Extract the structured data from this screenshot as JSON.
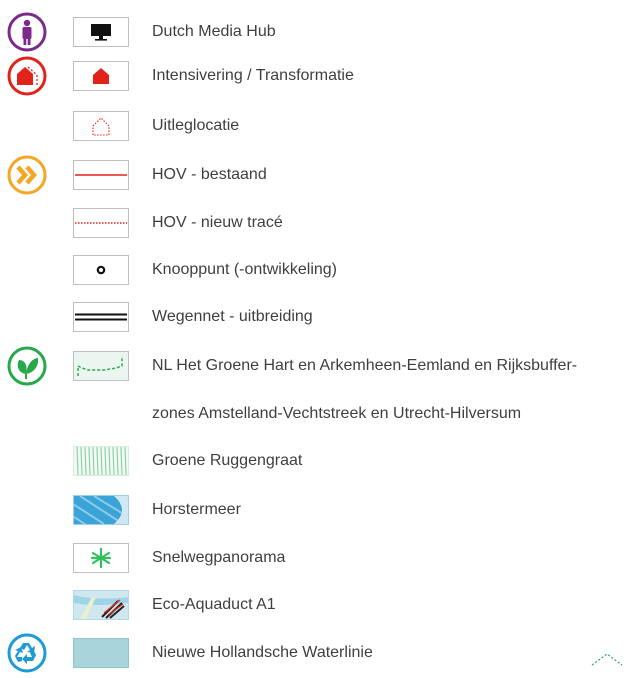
{
  "legend": {
    "items": [
      {
        "label": "Dutch Media Hub",
        "icon": "media-hub-person-icon",
        "swatch": "monitor-icon"
      },
      {
        "label": "Intensivering / Transformatie",
        "icon": "house-transform-icon",
        "swatch": "red-house-icon"
      },
      {
        "label": "Uitleglocatie",
        "swatch": "dotted-house-icon"
      },
      {
        "label": "HOV - bestaand",
        "icon": "chevron-right-double-icon",
        "swatch": "solid-red-line-icon"
      },
      {
        "label": "HOV - nieuw tracé",
        "swatch": "dotted-red-line-icon"
      },
      {
        "label": "Knooppunt (-ontwikkeling)",
        "swatch": "ring-node-icon"
      },
      {
        "label": "Wegennet - uitbreiding",
        "swatch": "double-road-icon"
      },
      {
        "label": "NL Het Groene Hart  en Arkemheen-Eemland en Rijksbuffer-",
        "icon": "leaf-icon",
        "swatch": "green-dashed-border-icon"
      },
      {
        "label": "zones Amstelland-Vechtstreek en Utrecht-Hilversum"
      },
      {
        "label": "Groene Ruggengraat",
        "swatch": "green-hatch-icon"
      },
      {
        "label": "Horstermeer",
        "swatch": "blue-stripes-icon"
      },
      {
        "label": "Snelwegpanorama",
        "swatch": "green-asterisk-icon"
      },
      {
        "label": "Eco-Aquaduct A1",
        "swatch": "aquaduct-photo-icon"
      },
      {
        "label": "Nieuwe Hollandsche Waterlinie",
        "icon": "recycle-icon",
        "swatch": "light-blue-fill-icon"
      }
    ]
  },
  "colors": {
    "purple": "#7b2a8c",
    "red": "#e2231a",
    "orange": "#f5a623",
    "green": "#27a84a",
    "blue": "#1e9ad6",
    "waterlinie": "#a8d5dc"
  }
}
